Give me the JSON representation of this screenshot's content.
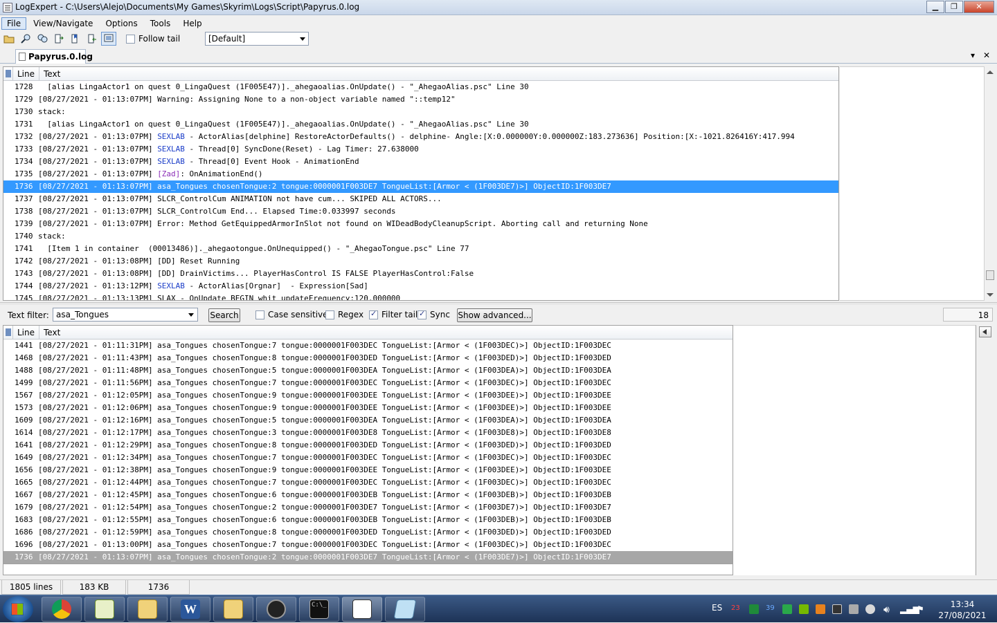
{
  "window": {
    "title": "LogExpert - C:\\Users\\Alejo\\Documents\\My Games\\Skyrim\\Logs\\Script\\Papyrus.0.log"
  },
  "menu": [
    "File",
    "View/Navigate",
    "Options",
    "Tools",
    "Help"
  ],
  "toolbar": {
    "follow_tail_label": "Follow tail",
    "highlight_group": "[Default]"
  },
  "tab": {
    "label": "Papyrus.0.log"
  },
  "log_view": {
    "columns": [
      "Line",
      "Text"
    ],
    "rows": [
      {
        "line": "1728",
        "text": "  [alias LingaActor1 on quest 0_LingaQuest (1F005E47)]._ahegaoalias.OnUpdate() - \"_AhegaoAlias.psc\" Line 30"
      },
      {
        "line": "1729",
        "text": "[08/27/2021 - 01:13:07PM] Warning: Assigning None to a non-object variable named \"::temp12\""
      },
      {
        "line": "1730",
        "text": "stack:"
      },
      {
        "line": "1731",
        "text": "  [alias LingaActor1 on quest 0_LingaQuest (1F005E47)]._ahegaoalias.OnUpdate() - \"_AhegaoAlias.psc\" Line 30"
      },
      {
        "line": "1732",
        "pre": "[08/27/2021 - 01:13:07PM] ",
        "kw": "SEXLAB",
        "post": " - ActorAlias[delphine] RestoreActorDefaults() - delphine- Angle:[X:0.000000Y:0.000000Z:183.273636] Position:[X:-1021.826416Y:417.994"
      },
      {
        "line": "1733",
        "pre": "[08/27/2021 - 01:13:07PM] ",
        "kw": "SEXLAB",
        "post": " - Thread[0] SyncDone(Reset) - Lag Timer: 27.638000"
      },
      {
        "line": "1734",
        "pre": "[08/27/2021 - 01:13:07PM] ",
        "kw": "SEXLAB",
        "post": " - Thread[0] Event Hook - AnimationEnd"
      },
      {
        "line": "1735",
        "pre": "[08/27/2021 - 01:13:07PM] ",
        "kw": "[Zad]",
        "post": ": OnAnimationEnd()",
        "kwclass": "kw-zad"
      },
      {
        "line": "1736",
        "text": "[08/27/2021 - 01:13:07PM] asa_Tongues chosenTongue:2 tongue:0000001F003DE7 TongueList:[Armor < (1F003DE7)>] ObjectID:1F003DE7",
        "selected": true
      },
      {
        "line": "1737",
        "text": "[08/27/2021 - 01:13:07PM] SLCR_ControlCum ANIMATION not have cum... SKIPED ALL ACTORS..."
      },
      {
        "line": "1738",
        "text": "[08/27/2021 - 01:13:07PM] SLCR_ControlCum End... Elapsed Time:0.033997 seconds"
      },
      {
        "line": "1739",
        "text": "[08/27/2021 - 01:13:07PM] Error: Method GetEquippedArmorInSlot not found on WIDeadBodyCleanupScript. Aborting call and returning None"
      },
      {
        "line": "1740",
        "text": "stack:"
      },
      {
        "line": "1741",
        "text": "  [Item 1 in container  (00013486)]._ahegaotongue.OnUnequipped() - \"_AhegaoTongue.psc\" Line 77"
      },
      {
        "line": "1742",
        "text": "[08/27/2021 - 01:13:08PM] [DD] Reset Running"
      },
      {
        "line": "1743",
        "text": "[08/27/2021 - 01:13:08PM] [DD] DrainVictims... PlayerHasControl IS FALSE PlayerHasControl:False"
      },
      {
        "line": "1744",
        "pre": "[08/27/2021 - 01:13:12PM] ",
        "kw": "SEXLAB",
        "post": " - ActorAlias[Orgnar]  - Expression[Sad]"
      },
      {
        "line": "1745",
        "text": "[08/27/2021 - 01:13:13PM] SLAX - OnUpdate BEGIN whit updateFrequency:120.000000"
      }
    ]
  },
  "filter": {
    "label": "Text filter:",
    "value": "asa_Tongues",
    "search_label": "Search",
    "case_sensitive_label": "Case sensitive",
    "regex_label": "Regex",
    "filter_tail_label": "Filter tail",
    "sync_label": "Sync",
    "show_advanced_label": "Show advanced...",
    "count": "18",
    "case_sensitive": false,
    "regex": false,
    "filter_tail": true,
    "sync": true
  },
  "filter_view": {
    "columns": [
      "Line",
      "Text"
    ],
    "rows": [
      {
        "line": "1441",
        "text": "[08/27/2021 - 01:11:31PM] asa_Tongues chosenTongue:7 tongue:0000001F003DEC TongueList:[Armor < (1F003DEC)>] ObjectID:1F003DEC"
      },
      {
        "line": "1468",
        "text": "[08/27/2021 - 01:11:43PM] asa_Tongues chosenTongue:8 tongue:0000001F003DED TongueList:[Armor < (1F003DED)>] ObjectID:1F003DED"
      },
      {
        "line": "1488",
        "text": "[08/27/2021 - 01:11:48PM] asa_Tongues chosenTongue:5 tongue:0000001F003DEA TongueList:[Armor < (1F003DEA)>] ObjectID:1F003DEA"
      },
      {
        "line": "1499",
        "text": "[08/27/2021 - 01:11:56PM] asa_Tongues chosenTongue:7 tongue:0000001F003DEC TongueList:[Armor < (1F003DEC)>] ObjectID:1F003DEC"
      },
      {
        "line": "1567",
        "text": "[08/27/2021 - 01:12:05PM] asa_Tongues chosenTongue:9 tongue:0000001F003DEE TongueList:[Armor < (1F003DEE)>] ObjectID:1F003DEE"
      },
      {
        "line": "1573",
        "text": "[08/27/2021 - 01:12:06PM] asa_Tongues chosenTongue:9 tongue:0000001F003DEE TongueList:[Armor < (1F003DEE)>] ObjectID:1F003DEE"
      },
      {
        "line": "1609",
        "text": "[08/27/2021 - 01:12:16PM] asa_Tongues chosenTongue:5 tongue:0000001F003DEA TongueList:[Armor < (1F003DEA)>] ObjectID:1F003DEA"
      },
      {
        "line": "1614",
        "text": "[08/27/2021 - 01:12:17PM] asa_Tongues chosenTongue:3 tongue:0000001F003DE8 TongueList:[Armor < (1F003DE8)>] ObjectID:1F003DE8"
      },
      {
        "line": "1641",
        "text": "[08/27/2021 - 01:12:29PM] asa_Tongues chosenTongue:8 tongue:0000001F003DED TongueList:[Armor < (1F003DED)>] ObjectID:1F003DED"
      },
      {
        "line": "1649",
        "text": "[08/27/2021 - 01:12:34PM] asa_Tongues chosenTongue:7 tongue:0000001F003DEC TongueList:[Armor < (1F003DEC)>] ObjectID:1F003DEC"
      },
      {
        "line": "1656",
        "text": "[08/27/2021 - 01:12:38PM] asa_Tongues chosenTongue:9 tongue:0000001F003DEE TongueList:[Armor < (1F003DEE)>] ObjectID:1F003DEE"
      },
      {
        "line": "1665",
        "text": "[08/27/2021 - 01:12:44PM] asa_Tongues chosenTongue:7 tongue:0000001F003DEC TongueList:[Armor < (1F003DEC)>] ObjectID:1F003DEC"
      },
      {
        "line": "1667",
        "text": "[08/27/2021 - 01:12:45PM] asa_Tongues chosenTongue:6 tongue:0000001F003DEB TongueList:[Armor < (1F003DEB)>] ObjectID:1F003DEB"
      },
      {
        "line": "1679",
        "text": "[08/27/2021 - 01:12:54PM] asa_Tongues chosenTongue:2 tongue:0000001F003DE7 TongueList:[Armor < (1F003DE7)>] ObjectID:1F003DE7"
      },
      {
        "line": "1683",
        "text": "[08/27/2021 - 01:12:55PM] asa_Tongues chosenTongue:6 tongue:0000001F003DEB TongueList:[Armor < (1F003DEB)>] ObjectID:1F003DEB"
      },
      {
        "line": "1686",
        "text": "[08/27/2021 - 01:12:59PM] asa_Tongues chosenTongue:8 tongue:0000001F003DED TongueList:[Armor < (1F003DED)>] ObjectID:1F003DED"
      },
      {
        "line": "1696",
        "text": "[08/27/2021 - 01:13:00PM] asa_Tongues chosenTongue:7 tongue:0000001F003DEC TongueList:[Armor < (1F003DEC)>] ObjectID:1F003DEC"
      },
      {
        "line": "1736",
        "text": "[08/27/2021 - 01:13:07PM] asa_Tongues chosenTongue:2 tongue:0000001F003DE7 TongueList:[Armor < (1F003DE7)>] ObjectID:1F003DE7",
        "selected": true
      }
    ]
  },
  "status": {
    "lines": "1805 lines",
    "size": "183 KB",
    "current_line": "1736"
  },
  "taskbar": {
    "apps": [
      "chrome-icon",
      "notepad-icon",
      "folder-icon",
      "word-icon",
      "folder-icon",
      "creation-kit-icon",
      "console-icon",
      "logexpert-icon",
      "notepad-app-icon"
    ],
    "lang": "ES",
    "tray_numbers": [
      "23",
      "39"
    ],
    "time": "13:34",
    "date": "27/08/2021"
  },
  "colors": {
    "selection": "#3399ff",
    "selection_inactive": "#a7a7a7",
    "keyword": "#1a3cc8",
    "keyword_zad": "#8a2bb6",
    "taskbar": "#1d3356"
  }
}
